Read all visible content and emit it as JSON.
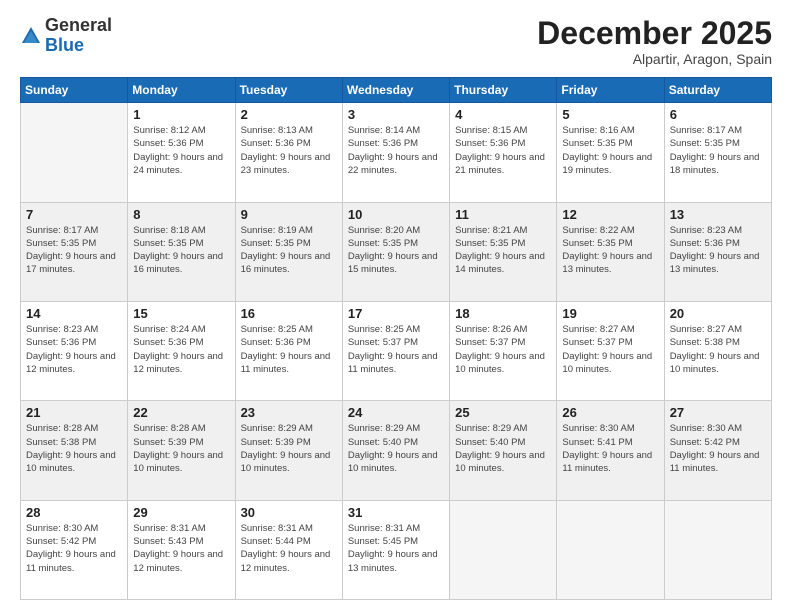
{
  "logo": {
    "general": "General",
    "blue": "Blue"
  },
  "title": "December 2025",
  "location": "Alpartir, Aragon, Spain",
  "weekdays": [
    "Sunday",
    "Monday",
    "Tuesday",
    "Wednesday",
    "Thursday",
    "Friday",
    "Saturday"
  ],
  "weeks": [
    [
      {
        "day": "",
        "empty": true
      },
      {
        "day": "1",
        "sunrise": "8:12 AM",
        "sunset": "5:36 PM",
        "daylight": "9 hours and 24 minutes."
      },
      {
        "day": "2",
        "sunrise": "8:13 AM",
        "sunset": "5:36 PM",
        "daylight": "9 hours and 23 minutes."
      },
      {
        "day": "3",
        "sunrise": "8:14 AM",
        "sunset": "5:36 PM",
        "daylight": "9 hours and 22 minutes."
      },
      {
        "day": "4",
        "sunrise": "8:15 AM",
        "sunset": "5:36 PM",
        "daylight": "9 hours and 21 minutes."
      },
      {
        "day": "5",
        "sunrise": "8:16 AM",
        "sunset": "5:35 PM",
        "daylight": "9 hours and 19 minutes."
      },
      {
        "day": "6",
        "sunrise": "8:17 AM",
        "sunset": "5:35 PM",
        "daylight": "9 hours and 18 minutes."
      }
    ],
    [
      {
        "day": "7",
        "sunrise": "8:17 AM",
        "sunset": "5:35 PM",
        "daylight": "9 hours and 17 minutes."
      },
      {
        "day": "8",
        "sunrise": "8:18 AM",
        "sunset": "5:35 PM",
        "daylight": "9 hours and 16 minutes."
      },
      {
        "day": "9",
        "sunrise": "8:19 AM",
        "sunset": "5:35 PM",
        "daylight": "9 hours and 16 minutes."
      },
      {
        "day": "10",
        "sunrise": "8:20 AM",
        "sunset": "5:35 PM",
        "daylight": "9 hours and 15 minutes."
      },
      {
        "day": "11",
        "sunrise": "8:21 AM",
        "sunset": "5:35 PM",
        "daylight": "9 hours and 14 minutes."
      },
      {
        "day": "12",
        "sunrise": "8:22 AM",
        "sunset": "5:35 PM",
        "daylight": "9 hours and 13 minutes."
      },
      {
        "day": "13",
        "sunrise": "8:23 AM",
        "sunset": "5:36 PM",
        "daylight": "9 hours and 13 minutes."
      }
    ],
    [
      {
        "day": "14",
        "sunrise": "8:23 AM",
        "sunset": "5:36 PM",
        "daylight": "9 hours and 12 minutes."
      },
      {
        "day": "15",
        "sunrise": "8:24 AM",
        "sunset": "5:36 PM",
        "daylight": "9 hours and 12 minutes."
      },
      {
        "day": "16",
        "sunrise": "8:25 AM",
        "sunset": "5:36 PM",
        "daylight": "9 hours and 11 minutes."
      },
      {
        "day": "17",
        "sunrise": "8:25 AM",
        "sunset": "5:37 PM",
        "daylight": "9 hours and 11 minutes."
      },
      {
        "day": "18",
        "sunrise": "8:26 AM",
        "sunset": "5:37 PM",
        "daylight": "9 hours and 10 minutes."
      },
      {
        "day": "19",
        "sunrise": "8:27 AM",
        "sunset": "5:37 PM",
        "daylight": "9 hours and 10 minutes."
      },
      {
        "day": "20",
        "sunrise": "8:27 AM",
        "sunset": "5:38 PM",
        "daylight": "9 hours and 10 minutes."
      }
    ],
    [
      {
        "day": "21",
        "sunrise": "8:28 AM",
        "sunset": "5:38 PM",
        "daylight": "9 hours and 10 minutes."
      },
      {
        "day": "22",
        "sunrise": "8:28 AM",
        "sunset": "5:39 PM",
        "daylight": "9 hours and 10 minutes."
      },
      {
        "day": "23",
        "sunrise": "8:29 AM",
        "sunset": "5:39 PM",
        "daylight": "9 hours and 10 minutes."
      },
      {
        "day": "24",
        "sunrise": "8:29 AM",
        "sunset": "5:40 PM",
        "daylight": "9 hours and 10 minutes."
      },
      {
        "day": "25",
        "sunrise": "8:29 AM",
        "sunset": "5:40 PM",
        "daylight": "9 hours and 10 minutes."
      },
      {
        "day": "26",
        "sunrise": "8:30 AM",
        "sunset": "5:41 PM",
        "daylight": "9 hours and 11 minutes."
      },
      {
        "day": "27",
        "sunrise": "8:30 AM",
        "sunset": "5:42 PM",
        "daylight": "9 hours and 11 minutes."
      }
    ],
    [
      {
        "day": "28",
        "sunrise": "8:30 AM",
        "sunset": "5:42 PM",
        "daylight": "9 hours and 11 minutes."
      },
      {
        "day": "29",
        "sunrise": "8:31 AM",
        "sunset": "5:43 PM",
        "daylight": "9 hours and 12 minutes."
      },
      {
        "day": "30",
        "sunrise": "8:31 AM",
        "sunset": "5:44 PM",
        "daylight": "9 hours and 12 minutes."
      },
      {
        "day": "31",
        "sunrise": "8:31 AM",
        "sunset": "5:45 PM",
        "daylight": "9 hours and 13 minutes."
      },
      {
        "day": "",
        "empty": true
      },
      {
        "day": "",
        "empty": true
      },
      {
        "day": "",
        "empty": true
      }
    ]
  ]
}
